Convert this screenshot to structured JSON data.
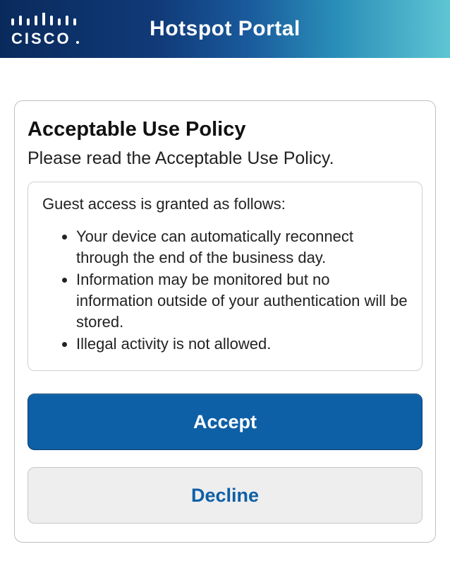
{
  "header": {
    "brand": "cisco",
    "title": "Hotspot Portal"
  },
  "card": {
    "title": "Acceptable Use Policy",
    "subtitle": "Please read the Acceptable Use Policy.",
    "policy": {
      "intro": "Guest access is granted as follows:",
      "items": [
        "Your device can automatically reconnect through the end of the business day.",
        "Information may be monitored but no information outside of your authentication will be stored.",
        "Illegal activity is not allowed."
      ]
    },
    "accept_label": "Accept",
    "decline_label": "Decline"
  }
}
